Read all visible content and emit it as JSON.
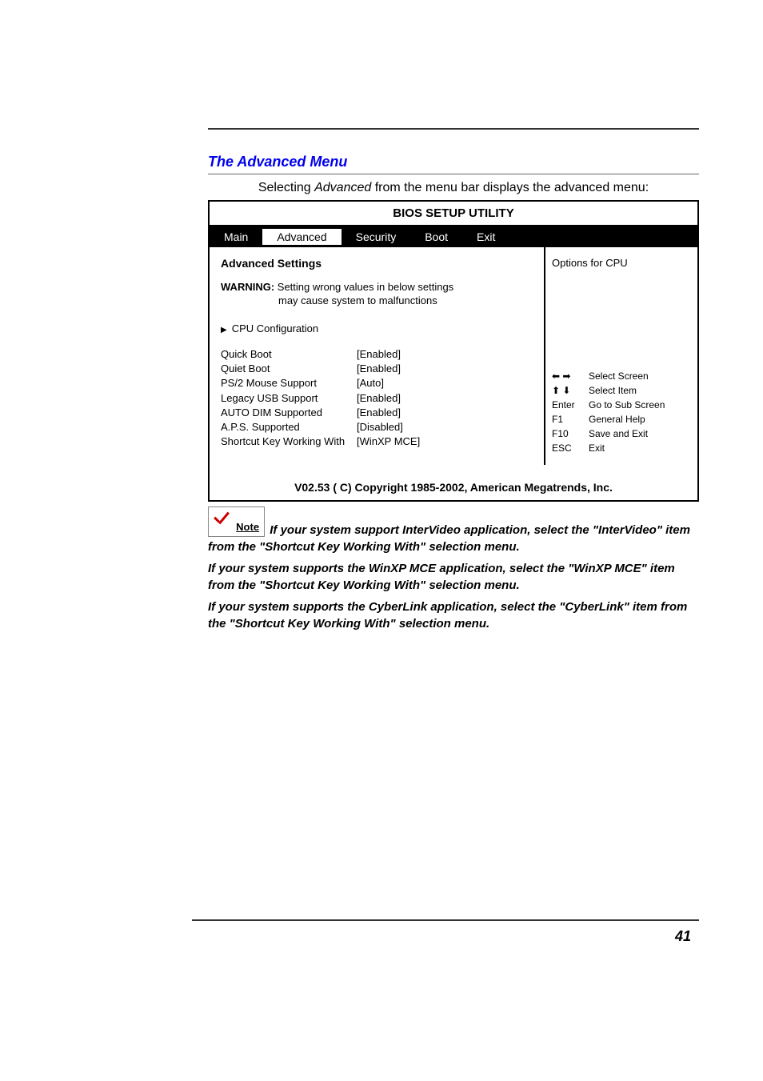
{
  "section_title": "The Advanced Menu",
  "intro_prefix": "Selecting ",
  "intro_em": "Advanced",
  "intro_suffix": " from the menu bar displays the advanced menu:",
  "bios": {
    "title": "BIOS SETUP UTILITY",
    "menus": [
      "Main",
      "Advanced",
      "Security",
      "Boot",
      "Exit"
    ],
    "panel_title": "Advanced Settings",
    "warning_label": "WARNING:",
    "warning_text": " Setting wrong values in below settings",
    "warning_sub": "may cause system to malfunctions",
    "submenu": "CPU Configuration",
    "settings": [
      {
        "label": "Quick Boot",
        "value": "[Enabled]"
      },
      {
        "label": "Quiet Boot",
        "value": "[Enabled]"
      },
      {
        "label": "PS/2 Mouse Support",
        "value": "[Auto]"
      },
      {
        "label": "Legacy USB Support",
        "value": "[Enabled]"
      },
      {
        "label": "AUTO DIM Supported",
        "value": "[Enabled]"
      },
      {
        "label": "A.P.S. Supported",
        "value": "[Disabled]"
      },
      {
        "label": "Shortcut Key Working With",
        "value": "[WinXP MCE]"
      }
    ],
    "options_text": "Options for CPU",
    "keys": [
      {
        "key": "⬅ ➡",
        "desc": "Select Screen"
      },
      {
        "key": "⬆ ⬇",
        "desc": "Select Item"
      },
      {
        "key": "Enter",
        "desc": "Go to Sub Screen"
      },
      {
        "key": "F1",
        "desc": "General Help"
      },
      {
        "key": "F10",
        "desc": "Save and Exit"
      },
      {
        "key": "ESC",
        "desc": "Exit"
      }
    ],
    "footer": "V02.53  ( C) Copyright 1985-2002, American Megatrends, Inc."
  },
  "note_label": "Note",
  "note1": "If your system support InterVideo application, select the \"InterVideo\" item from the \"Shortcut Key Working With\" selection menu.",
  "note2": "If your system supports the WinXP MCE application, select the \"WinXP MCE\" item from the \"Shortcut Key Working With\" selection menu.",
  "note3": "If your system supports the CyberLink application, select the \"CyberLink\" item from the \"Shortcut Key Working With\" selection menu.",
  "page_number": "41"
}
